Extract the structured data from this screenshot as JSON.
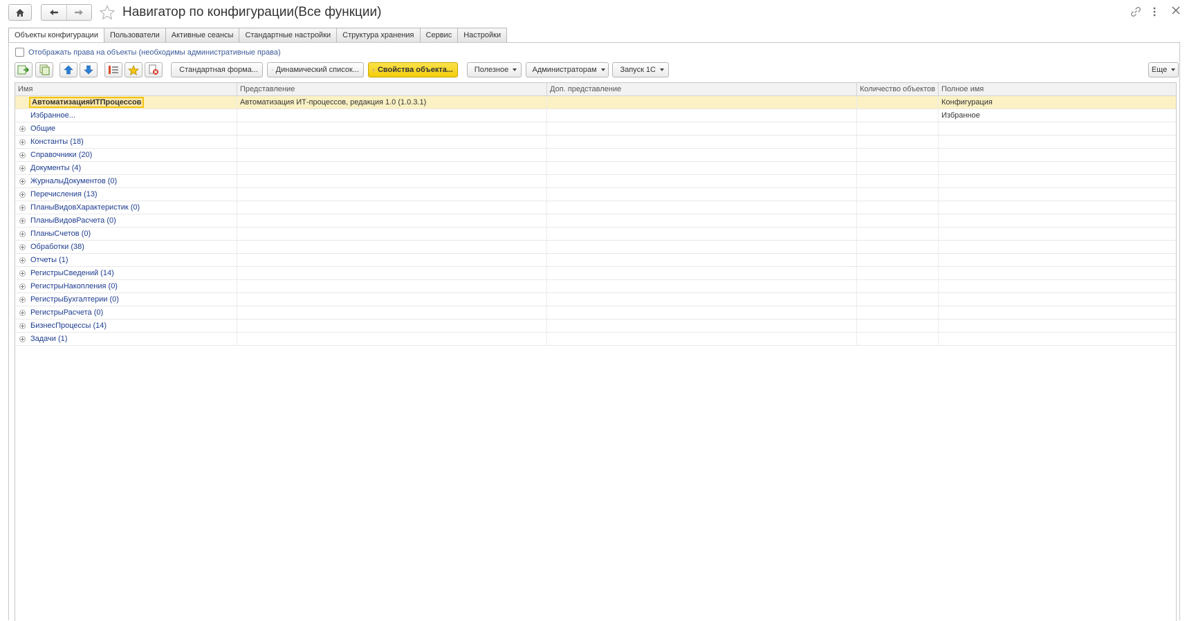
{
  "window": {
    "title": "Навигатор по конфигурации(Все функции)",
    "icons": {
      "home": "home-icon",
      "back": "arrow-left-icon",
      "forward": "arrow-right-icon",
      "favorite": "star-icon",
      "link": "link-icon",
      "more": "more-vertical-icon",
      "close": "close-icon"
    }
  },
  "tabs": [
    {
      "label": "Объекты конфигурации",
      "active": true
    },
    {
      "label": "Пользователи",
      "active": false
    },
    {
      "label": "Активные сеансы",
      "active": false
    },
    {
      "label": "Стандартные настройки",
      "active": false
    },
    {
      "label": "Структура хранения",
      "active": false
    },
    {
      "label": "Сервис",
      "active": false
    },
    {
      "label": "Настройки",
      "active": false
    }
  ],
  "options": {
    "show_rights_label": "Отображать права на объекты (необходимы административные права)",
    "show_rights_checked": false
  },
  "toolbar": {
    "standard_form": "Стандартная форма...",
    "dynamic_list": "Динамический список...",
    "object_properties": "Свойства объекта...",
    "useful": "Полезное",
    "administrators": "Администраторам",
    "launch_1c": "Запуск 1С",
    "more": "Еще"
  },
  "table": {
    "headers": [
      "Имя",
      "Представление",
      "Доп. представление",
      "Количество объектов",
      "Полное имя"
    ],
    "rows": [
      {
        "name": "АвтоматизацияИТПроцессов",
        "presentation": "Автоматизация ИТ-процессов, редакция 1.0 (1.0.3.1)",
        "extra": "",
        "count": "",
        "full_name": "Конфигурация",
        "expandable": false,
        "selected": true
      },
      {
        "name": "Избранное...",
        "presentation": "",
        "extra": "",
        "count": "",
        "full_name": "Избранное",
        "expandable": false,
        "selected": false
      },
      {
        "name": "Общие",
        "presentation": "",
        "extra": "",
        "count": "",
        "full_name": "",
        "expandable": true
      },
      {
        "name": "Константы (18)",
        "presentation": "",
        "extra": "",
        "count": "",
        "full_name": "",
        "expandable": true
      },
      {
        "name": "Справочники (20)",
        "presentation": "",
        "extra": "",
        "count": "",
        "full_name": "",
        "expandable": true
      },
      {
        "name": "Документы (4)",
        "presentation": "",
        "extra": "",
        "count": "",
        "full_name": "",
        "expandable": true
      },
      {
        "name": "ЖурналыДокументов (0)",
        "presentation": "",
        "extra": "",
        "count": "",
        "full_name": "",
        "expandable": true
      },
      {
        "name": "Перечисления (13)",
        "presentation": "",
        "extra": "",
        "count": "",
        "full_name": "",
        "expandable": true
      },
      {
        "name": "ПланыВидовХарактеристик (0)",
        "presentation": "",
        "extra": "",
        "count": "",
        "full_name": "",
        "expandable": true
      },
      {
        "name": "ПланыВидовРасчета (0)",
        "presentation": "",
        "extra": "",
        "count": "",
        "full_name": "",
        "expandable": true
      },
      {
        "name": "ПланыСчетов (0)",
        "presentation": "",
        "extra": "",
        "count": "",
        "full_name": "",
        "expandable": true
      },
      {
        "name": "Обработки (38)",
        "presentation": "",
        "extra": "",
        "count": "",
        "full_name": "",
        "expandable": true
      },
      {
        "name": "Отчеты (1)",
        "presentation": "",
        "extra": "",
        "count": "",
        "full_name": "",
        "expandable": true
      },
      {
        "name": "РегистрыСведений (14)",
        "presentation": "",
        "extra": "",
        "count": "",
        "full_name": "",
        "expandable": true
      },
      {
        "name": "РегистрыНакопления (0)",
        "presentation": "",
        "extra": "",
        "count": "",
        "full_name": "",
        "expandable": true
      },
      {
        "name": "РегистрыБухгалтерии (0)",
        "presentation": "",
        "extra": "",
        "count": "",
        "full_name": "",
        "expandable": true
      },
      {
        "name": "РегистрыРасчета (0)",
        "presentation": "",
        "extra": "",
        "count": "",
        "full_name": "",
        "expandable": true
      },
      {
        "name": "БизнесПроцессы (14)",
        "presentation": "",
        "extra": "",
        "count": "",
        "full_name": "",
        "expandable": true
      },
      {
        "name": "Задачи (1)",
        "presentation": "",
        "extra": "",
        "count": "",
        "full_name": "",
        "expandable": true
      }
    ]
  }
}
